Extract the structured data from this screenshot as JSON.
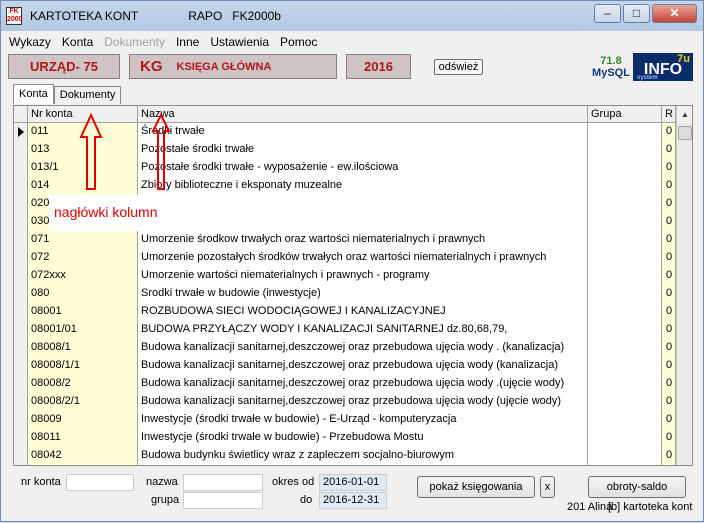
{
  "window": {
    "title": "KARTOTEKA KONT",
    "subtitle": "RAPO   FK2000b",
    "logo_text": "FK 2000",
    "controls": {
      "minimize": "–",
      "maximize": "□",
      "close": "✕"
    }
  },
  "menu": [
    "Wykazy",
    "Konta",
    "Dokumenty",
    "Inne",
    "Ustawienia",
    "Pomoc"
  ],
  "header": {
    "office": "URZĄD- 75",
    "kg_code": "KG",
    "kg_name": "KSIĘGA GŁÓWNA",
    "year": "2016",
    "refresh_label": "odśwież",
    "mysql_version": "71.8",
    "mysql_label": "MySQL",
    "info_logo": "INFO",
    "info_logo_num": "7u",
    "info_logo_sub": "system"
  },
  "tabs": [
    "Konta",
    "Dokumenty"
  ],
  "grid": {
    "columns": [
      "Nr konta",
      "Nazwa",
      "Grupa",
      "R"
    ],
    "rows": [
      {
        "nr": "011",
        "name": "Środki trwałe",
        "grp": "",
        "r": "0"
      },
      {
        "nr": "013",
        "name": "Pozostałe środki trwałe",
        "grp": "",
        "r": "0"
      },
      {
        "nr": "013/1",
        "name": "Pozostałe środki trwałe - wyposażenie - ew.ilościowa",
        "grp": "",
        "r": "0"
      },
      {
        "nr": "014",
        "name": "Zbiory biblioteczne i eksponaty muzealne",
        "grp": "",
        "r": "0"
      },
      {
        "nr": "020",
        "name": "",
        "grp": "",
        "r": "0"
      },
      {
        "nr": "030",
        "name": "",
        "grp": "",
        "r": "0"
      },
      {
        "nr": "071",
        "name": "Umorzenie środkow trwałych oraz wartości niematerialnych i prawnych",
        "grp": "",
        "r": "0"
      },
      {
        "nr": "072",
        "name": "Umorzenie pozostałych środków trwałych oraz wartości niematerialnych i prawnych",
        "grp": "",
        "r": "0"
      },
      {
        "nr": "072xxx",
        "name": "Umorzenie wartości niematerialnych i prawnych - programy",
        "grp": "",
        "r": "0"
      },
      {
        "nr": "080",
        "name": "Srodki trwałe w budowie (inwestycje)",
        "grp": "",
        "r": "0"
      },
      {
        "nr": "08001",
        "name": "ROZBUDOWA SIECI WODOCIĄGOWEJ I KANALIZACYJNEJ",
        "grp": "",
        "r": "0"
      },
      {
        "nr": "08001/01",
        "name": "BUDOWA PRZYŁĄCZY WODY I KANALIZACJI SANITARNEJ   dz.80,68,79,",
        "grp": "",
        "r": "0"
      },
      {
        "nr": "08008/1",
        "name": "Budowa kanalizacji sanitarnej,deszczowej  oraz przebudowa ujęcia wody . (kanalizacja)",
        "grp": "",
        "r": "0"
      },
      {
        "nr": "08008/1/1",
        "name": "Budowa kanalizacji sanitarnej,deszczowej oraz przebudowa ujęcia wody  (kanalizacja)",
        "grp": "",
        "r": "0"
      },
      {
        "nr": "08008/2",
        "name": "Budowa kanalizacji sanitarnej,deszczowej oraz przebudowa ujęcia wody .(ujęcie wody)",
        "grp": "",
        "r": "0"
      },
      {
        "nr": "08008/2/1",
        "name": "Budowa kanalizacji sanitarnej,deszczowej oraz przebudowa ujęcia wody (ujęcie wody)",
        "grp": "",
        "r": "0"
      },
      {
        "nr": "08009",
        "name": "Inwestycje (środki trwałe w budowie) - E-Urząd - komputeryzacja",
        "grp": "",
        "r": "0"
      },
      {
        "nr": "08011",
        "name": "Inwestycje (środki trwałe w budowie) - Przebudowa Mostu",
        "grp": "",
        "r": "0"
      },
      {
        "nr": "08042",
        "name": "Budowa budynku świetlicy wraz z zapleczem socjalno-biurowym",
        "grp": "",
        "r": "0"
      }
    ]
  },
  "annotation": "nagłówki kolumn",
  "filters": {
    "nr_konta_label": "nr konta",
    "nr_konta_value": "",
    "nazwa_label": "nazwa",
    "nazwa_value": "",
    "grupa_label": "grupa",
    "grupa_value": "",
    "okres_od_label": "okres od",
    "okres_od_value": "2016-01-01",
    "do_label": "do",
    "do_value": "2016-12-31",
    "pokaz_button": "pokaż księgowania",
    "x_button": "x",
    "obroty_button": "obroty-saldo"
  },
  "status": {
    "user": "201 Alina",
    "module": "[b] kartoteka kont"
  },
  "colors": {
    "header_text": "#b01818",
    "header_bg": "#cfc3c3",
    "nr_col_bg": "#ffffd7",
    "annotation": "#e00000"
  }
}
